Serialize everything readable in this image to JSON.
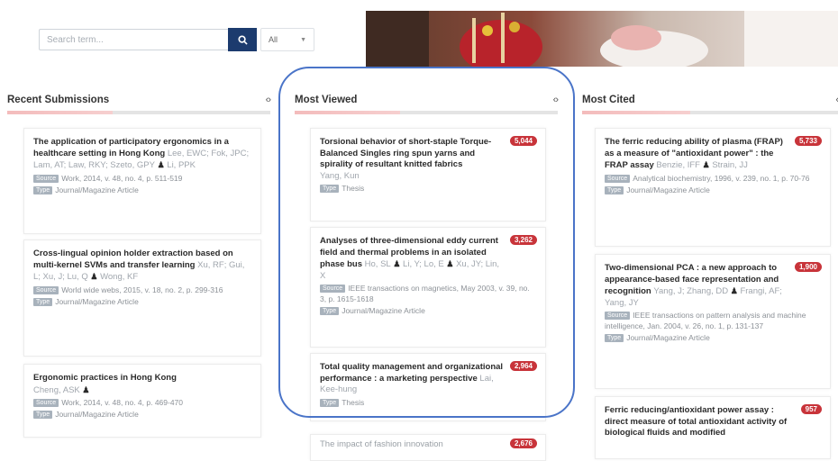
{
  "search": {
    "placeholder": "Search term...",
    "scope_selected": "All"
  },
  "columns": [
    {
      "title": "Recent Submissions",
      "items": [
        {
          "title": "The application of participatory ergonomics in a healthcare setting in Hong Kong",
          "authors": "Lee, EWC; Fok, JPC; Lam, AT; Law, RKY; Szeto, GPY",
          "authors2": "Li, PPK",
          "source": "Work, 2014, v. 48, no. 4, p. 511-519",
          "type": "Journal/Magazine Article"
        },
        {
          "title": "Cross-lingual opinion holder extraction based on multi-kernel SVMs and transfer learning",
          "authors": "Xu, RF; Gui, L; Xu, J; Lu, Q",
          "authors2": "Wong, KF",
          "source": "World wide webs, 2015, v. 18, no. 2, p. 299-316",
          "type": "Journal/Magazine Article"
        },
        {
          "title": "Ergonomic practices in Hong Kong",
          "authors": "Cheng, ASK",
          "source": "Work, 2014, v. 48, no. 4, p. 469-470",
          "type": "Journal/Magazine Article"
        }
      ]
    },
    {
      "title": "Most Viewed",
      "items": [
        {
          "title": "Torsional behavior of short-staple Torque-Balanced Singles ring spun yarns and spirality of resultant knitted fabrics",
          "count": "5,044",
          "authors": "Yang, Kun",
          "type": "Thesis"
        },
        {
          "title": "Analyses of three-dimensional eddy current field and thermal problems in an isolated phase bus",
          "count": "3,262",
          "authors": "Ho, SL",
          "authors2": "Li, Y; Lo, E",
          "authors3": "Xu, JY; Lin, X",
          "source": "IEEE transactions on magnetics, May 2003, v. 39, no. 3, p. 1615-1618",
          "type": "Journal/Magazine Article"
        },
        {
          "title": "Total quality management and organizational performance : a marketing perspective",
          "count": "2,964",
          "authors": "Lai, Kee-hung",
          "type": "Thesis"
        },
        {
          "title": "The impact of fashion innovation",
          "count": "2,676"
        }
      ]
    },
    {
      "title": "Most Cited",
      "items": [
        {
          "title": "The ferric reducing ability of plasma (FRAP) as a measure of \"antioxidant power\" : the FRAP assay",
          "count": "5,733",
          "authors": "Benzie, IFF",
          "authors2": "Strain, JJ",
          "source": "Analytical biochemistry, 1996, v. 239, no. 1, p. 70-76",
          "type": "Journal/Magazine Article"
        },
        {
          "title": "Two-dimensional PCA : a new approach to appearance-based face representation and recognition",
          "count": "1,900",
          "authors": "Yang, J; Zhang, DD",
          "authors2": "Frangi, AF; Yang, JY",
          "source": "IEEE transactions on pattern analysis and machine intelligence, Jan. 2004, v. 26, no. 1, p. 131-137",
          "type": "Journal/Magazine Article"
        },
        {
          "title": "Ferric reducing/antioxidant power assay : direct measure of total antioxidant activity of biological fluids and modified",
          "count": "957"
        }
      ]
    }
  ],
  "labels": {
    "source_tag": "Source",
    "type_tag": "Type"
  }
}
